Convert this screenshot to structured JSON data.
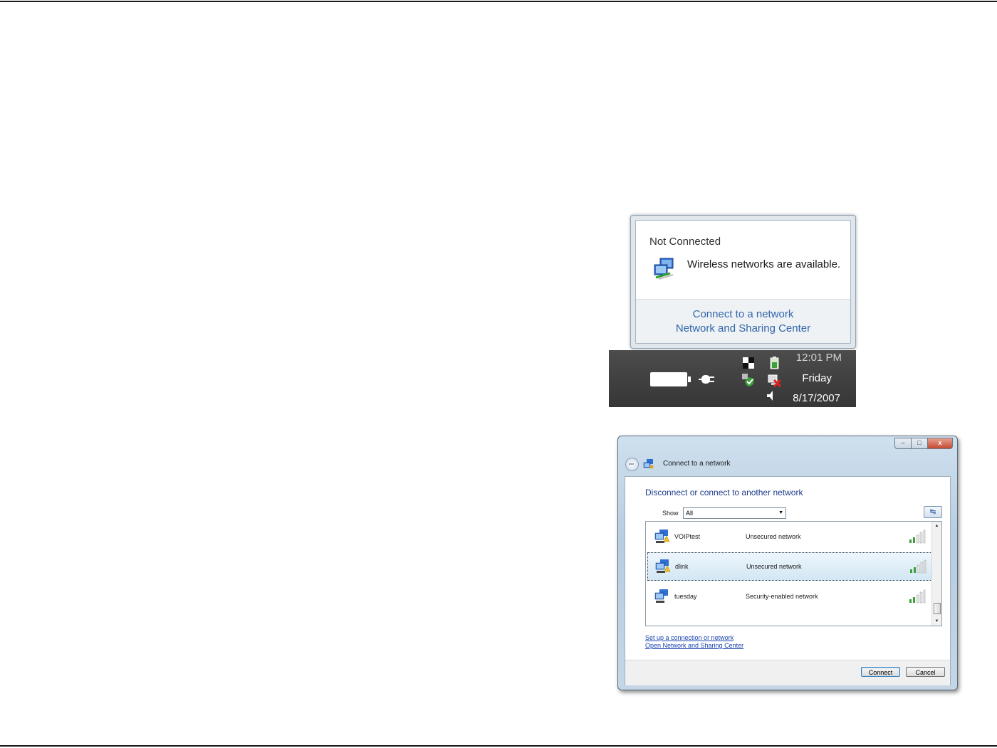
{
  "notification": {
    "title": "Not Connected",
    "message": "Wireless networks are available.",
    "links": [
      "Connect to a network",
      "Network and Sharing Center"
    ]
  },
  "taskbar": {
    "time": "12:01 PM",
    "day": "Friday",
    "date": "8/17/2007"
  },
  "dialog": {
    "title": "Connect to a network",
    "window_buttons": [
      "–",
      "□",
      "x"
    ],
    "heading": "Disconnect or connect to another network",
    "show_label": "Show",
    "show_value": "All",
    "networks": [
      {
        "name": "VOIPtest",
        "security": "Unsecured network"
      },
      {
        "name": "dlink",
        "security": "Unsecured network"
      },
      {
        "name": "tuesday",
        "security": "Security-enabled network"
      }
    ],
    "link_setup": "Set up a connection or network",
    "link_center": "Open Network and Sharing Center",
    "connect_label": "Connect",
    "cancel_label": "Cancel"
  },
  "colors": {
    "link": "#3366aa",
    "heading": "#1e3a8a",
    "selection": "#d2e7f4"
  }
}
